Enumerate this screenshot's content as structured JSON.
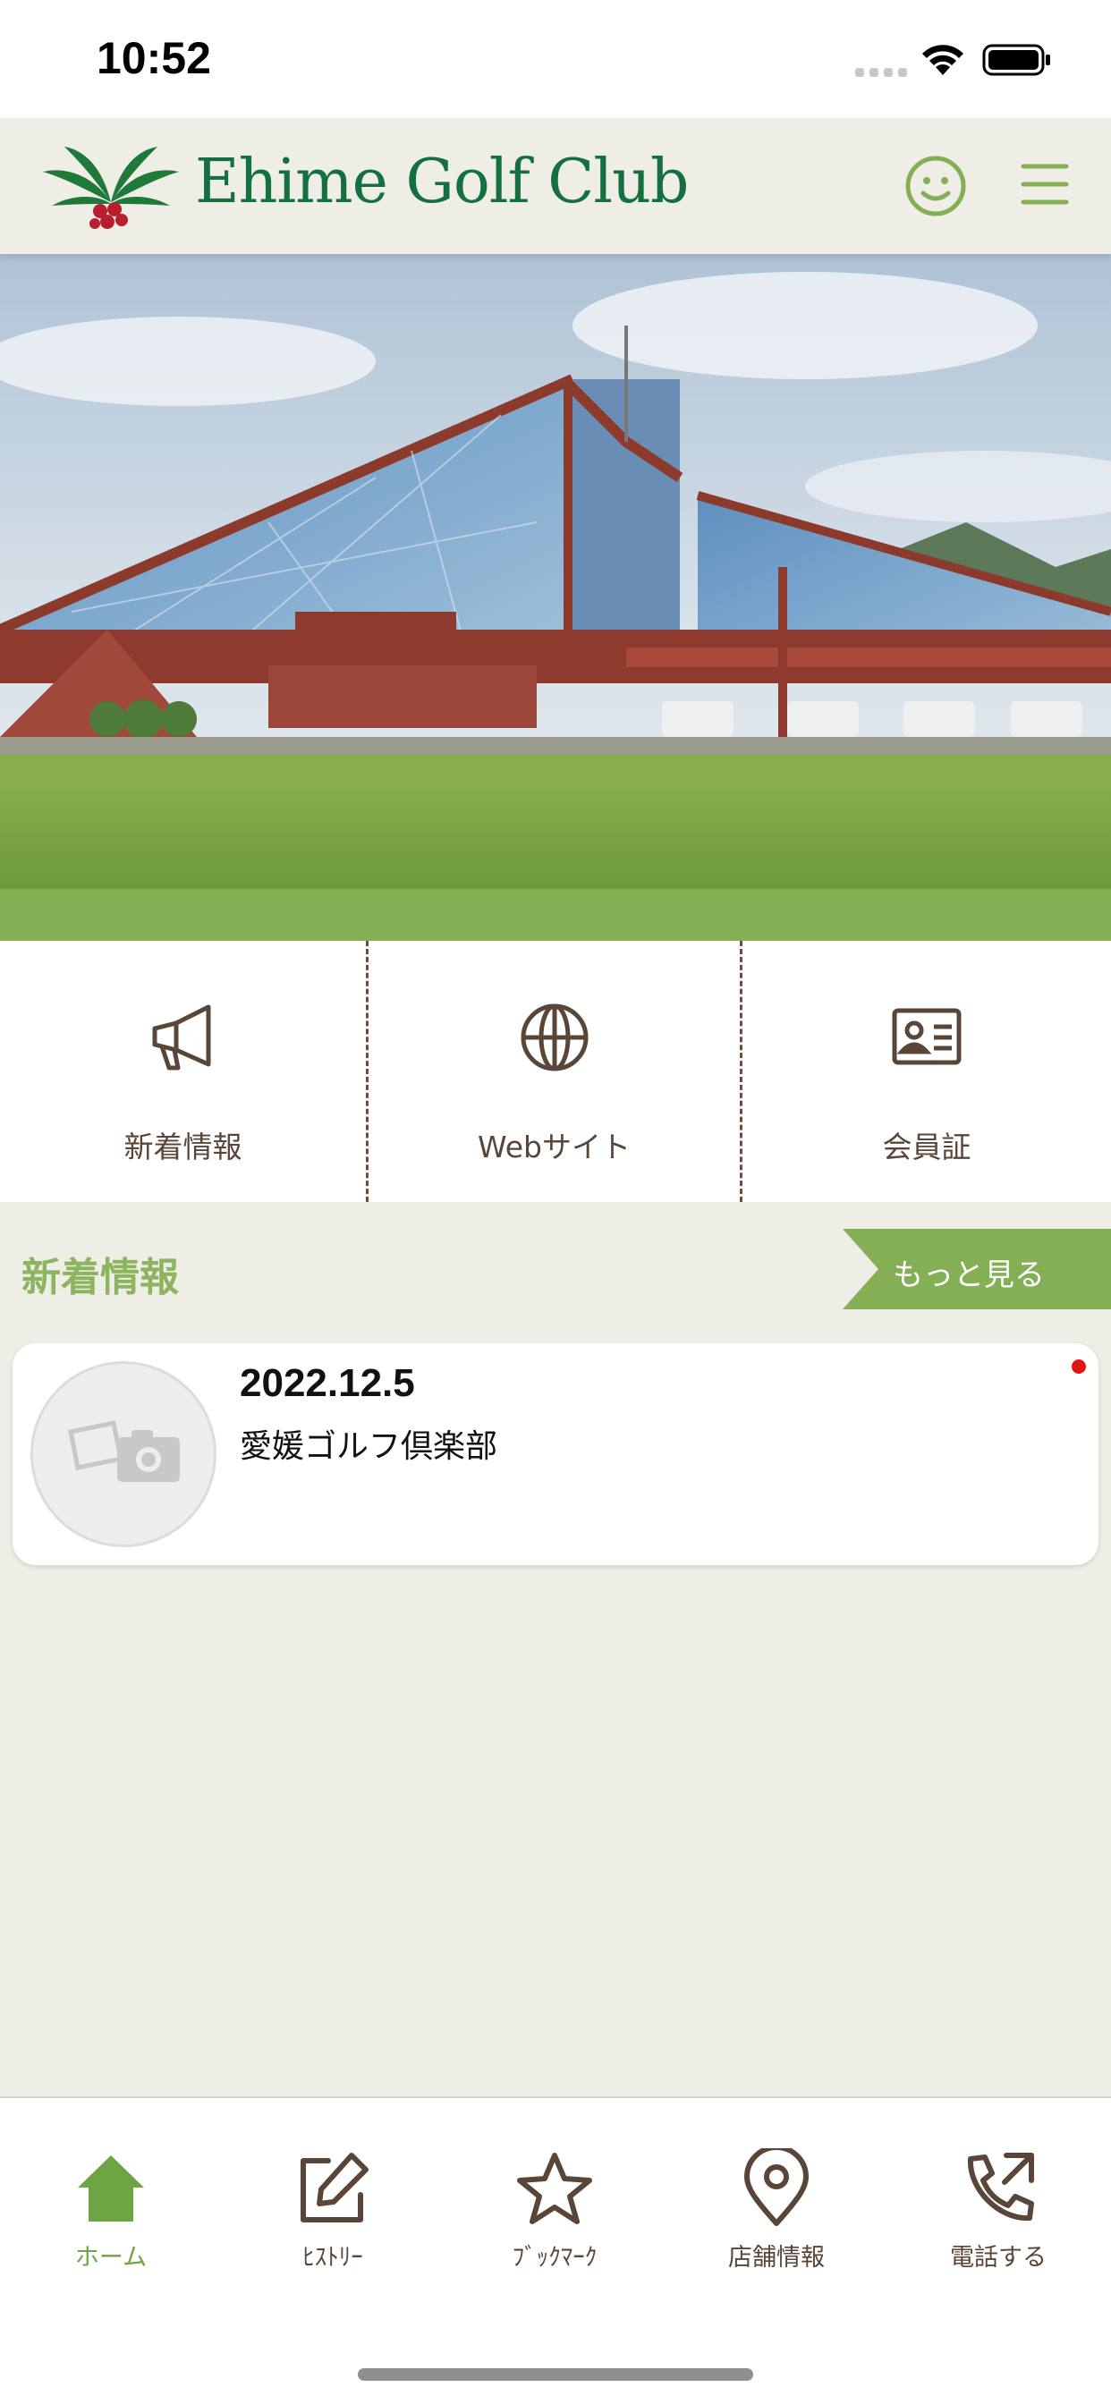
{
  "status_bar": {
    "time": "10:52",
    "icons": [
      "signal-dots-icon",
      "wifi-icon",
      "battery-icon"
    ]
  },
  "header": {
    "logo_text": "Ehime Golf Club",
    "logo_icon": "leaf-berries-logo-icon",
    "right_icons": [
      "smiley-face-icon",
      "hamburger-menu-icon"
    ]
  },
  "colors": {
    "header_bg": "#EEEDE6",
    "accent_green": "#85AF54",
    "logo_green": "#15703F",
    "brown": "#5A4638",
    "unread_red": "#E41414"
  },
  "quick_menu": [
    {
      "label": "新着情報",
      "icon": "megaphone-icon"
    },
    {
      "label": "Webサイト",
      "icon": "globe-icon"
    },
    {
      "label": "会員証",
      "icon": "member-card-icon"
    }
  ],
  "news_section": {
    "title": "新着情報",
    "more_label": "もっと見る",
    "items": [
      {
        "date": "2022.12.5",
        "title": "愛媛ゴルフ倶楽部",
        "thumb_icon": "photo-camera-placeholder-icon",
        "unread": true
      }
    ]
  },
  "tab_bar": {
    "active_index": 0,
    "tabs": [
      {
        "label": "ホーム",
        "icon": "home-icon"
      },
      {
        "label": "ﾋｽﾄﾘｰ",
        "icon": "edit-icon"
      },
      {
        "label": "ﾌﾞｯｸﾏｰｸ",
        "icon": "star-icon"
      },
      {
        "label": "店舗情報",
        "icon": "map-pin-icon"
      },
      {
        "label": "電話する",
        "icon": "phone-call-icon"
      }
    ]
  }
}
